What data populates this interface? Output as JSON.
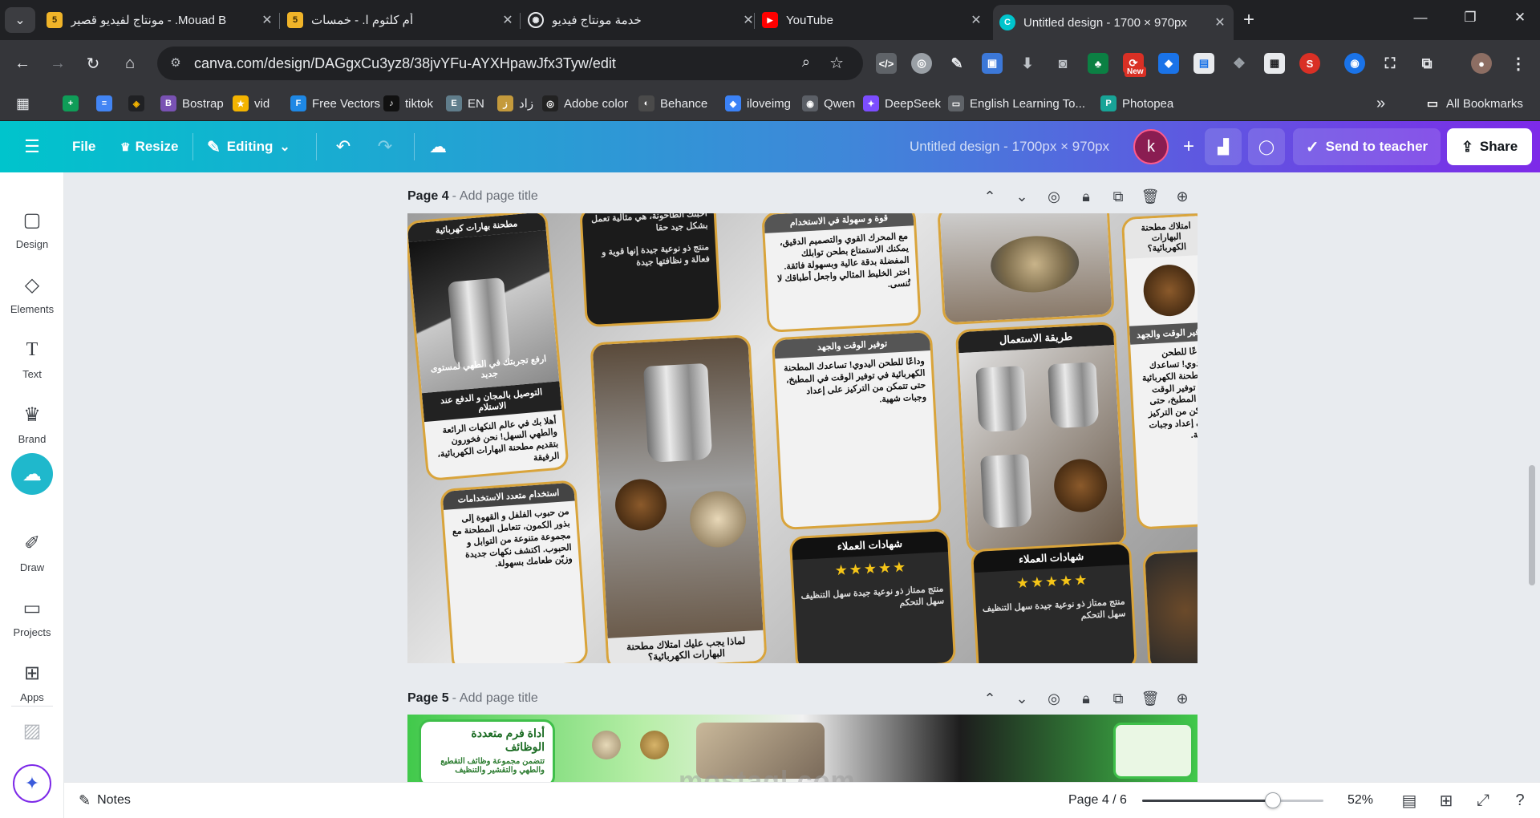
{
  "browser": {
    "tabs": [
      {
        "title": "Mouad B. - مونتاج لفيديو قصير",
        "favicon": "5"
      },
      {
        "title": "أم كلثوم ا. - خمسات",
        "favicon": "5"
      },
      {
        "title": "خدمة مونتاج فيديو",
        "favicon": "openai-icon"
      },
      {
        "title": "YouTube",
        "favicon": "youtube-icon"
      },
      {
        "title": "Untitled design - 1700 × 970px",
        "favicon": "canva-icon"
      }
    ],
    "url": "canva.com/design/DAGgxCu3yz8/38jvYFu-AYXHpawJfx3Tyw/edit",
    "new_badge": "New",
    "bookmarks": [
      {
        "label": "Bostrap",
        "color": "#7952b3",
        "glyph": "B"
      },
      {
        "label": "vid",
        "color": "#f4b400",
        "glyph": "★"
      },
      {
        "label": "Free Vectors",
        "color": "#1e88e5",
        "glyph": "F"
      },
      {
        "label": "tiktok",
        "color": "#111111",
        "glyph": "♪"
      },
      {
        "label": "EN",
        "color": "#607d8b",
        "glyph": "E"
      },
      {
        "label": "زاد",
        "color": "#c49a3c",
        "glyph": "ز"
      },
      {
        "label": "Adobe color",
        "color": "#222222",
        "glyph": "◎"
      },
      {
        "label": "Behance",
        "color": "#4a4a4a",
        "glyph": "◐"
      },
      {
        "label": "iloveimg",
        "color": "#3b82f6",
        "glyph": "◆"
      },
      {
        "label": "Qwen",
        "color": "#5b5f66",
        "glyph": "◉"
      },
      {
        "label": "DeepSeek",
        "color": "#7c4dff",
        "glyph": "✦"
      },
      {
        "label": "English Learning To...",
        "color": "#5f6368",
        "glyph": "▭"
      },
      {
        "label": "Photopea",
        "color": "#18a497",
        "glyph": "P"
      }
    ],
    "all_bookmarks": "All Bookmarks",
    "bookmark_overflow": "»"
  },
  "canva": {
    "menu": {
      "file": "File",
      "resize": "Resize",
      "editing": "Editing"
    },
    "doc_title": "Untitled design - 1700px × 970px",
    "avatar_initial": "k",
    "send_to_teacher": "Send to teacher",
    "share": "Share",
    "sidebar": [
      {
        "label": "Design",
        "icon": "design-icon"
      },
      {
        "label": "Elements",
        "icon": "elements-icon"
      },
      {
        "label": "Text",
        "icon": "text-icon"
      },
      {
        "label": "Brand",
        "icon": "brand-icon"
      },
      {
        "label": "Draw",
        "icon": "draw-icon"
      },
      {
        "label": "Projects",
        "icon": "projects-icon"
      },
      {
        "label": "Apps",
        "icon": "apps-icon"
      }
    ],
    "pages": [
      {
        "label": "Page 4",
        "title_placeholder": "Add page title"
      },
      {
        "label": "Page 5",
        "title_placeholder": "Add page title"
      }
    ],
    "page4_cards": {
      "c1_top": "مطحنة بهارات كهربائية",
      "c1_tagline": "ارفع تجربتك في الطهي لمستوى جديد",
      "c1_header": "التوصيل بالمجان و الدفع عند الاستلام",
      "c1_body": "أهلا بك في عالم النكهات الرائعة والطهي السهل! نحن فخورون بتقديم مطحنة البهارات الكهربائية، الرفيقة",
      "c2_body": "أحبتك الطاحونة، هي مثالية تعمل بشكل جيد حقا",
      "c2_review": "منتج ذو نوعية جيدة إنها قوية و فعالة و نظافتها جيدة",
      "c3_header": "قوة و سهولة في الاستخدام",
      "c3_body": "مع المحرك القوي والتصميم الدقيق، يمكنك الاستمتاع بطحن توابلك المفضلة بدقة عالية وبسهولة فائقة. اختر الخليط المثالي واجعل أطباقك لا تُنسى.",
      "c4_header": "امتلاك مطحنة البهارات الكهربائية؟",
      "c5_header": "توفير الوقت والجهد",
      "c5_body": "وداعًا للطحن اليدوي! تساعدك المطحنة الكهربائية في توفير الوقت في المطبخ، حتى تتمكن من التركيز على إعداد وجبات شهية.",
      "c6_header": "طريقة الاستعمال",
      "c7_header": "استخدام متعدد الاستخدامات",
      "c7_body": "من حبوب الفلفل و القهوة إلى بذور الكمون، تتعامل المطحنة مع مجموعة متنوعة من التوابل و الحبوب. اكتشف نكهات جديدة وزيّن طعامك بسهولة.",
      "c8_header": "لماذا يجب عليك امتلاك مطحنة البهارات الكهربائية؟",
      "c9_header": "شهادات العملاء",
      "c9_review": "منتج ممتاز ذو نوعية جيدة سهل التنظيف سهل التحكم",
      "stars": "★★★★★"
    },
    "page5_card": {
      "title": "أداة فرم متعددة الوظائف",
      "body": "تتضمن مجموعة وظائف التقطيع والطهي والتقشير والتنظيف"
    },
    "watermark": "mostaql.com",
    "footer": {
      "notes": "Notes",
      "page_indicator": "Page 4 / 6",
      "zoom_label": "52%",
      "zoom_fraction": 0.52
    }
  }
}
